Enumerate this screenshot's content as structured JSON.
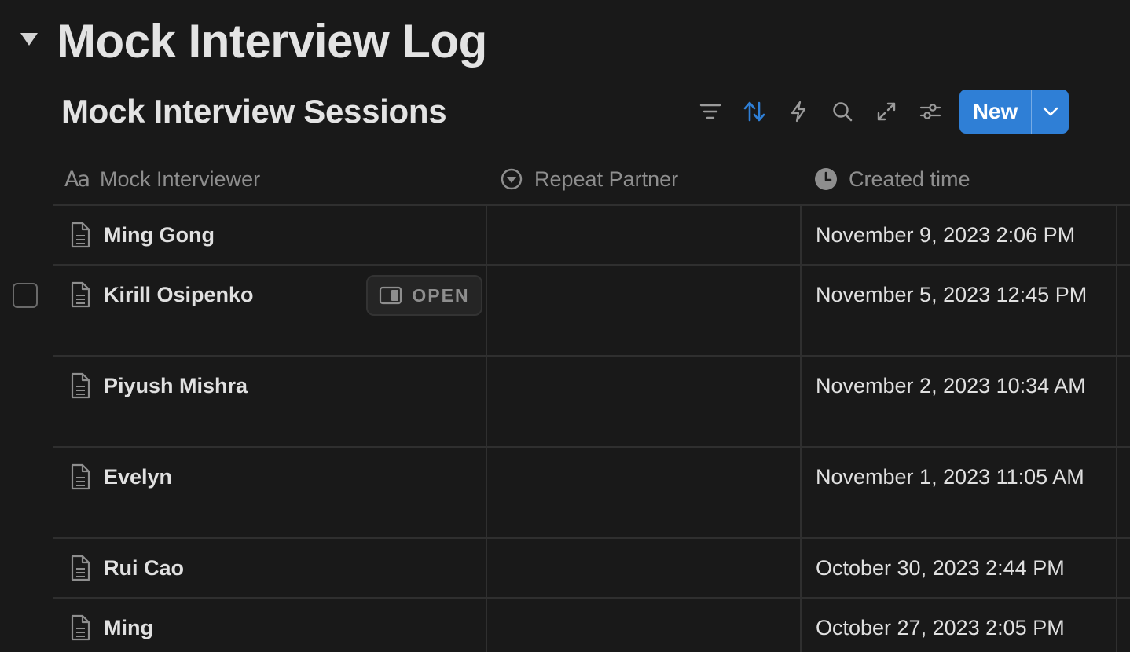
{
  "page": {
    "title": "Mock Interview Log"
  },
  "view": {
    "title": "Mock Interview Sessions"
  },
  "toolbar": {
    "icons": [
      "filter-icon",
      "sort-icon",
      "lightning-icon",
      "search-icon",
      "expand-icon",
      "settings-sliders-icon"
    ],
    "new_label": "New",
    "accent_color": "#2f7fd6",
    "active_icon_color": "#2f7fd6"
  },
  "table": {
    "columns": [
      {
        "label": "Mock Interviewer",
        "icon": "text-aa-icon"
      },
      {
        "label": "Repeat Partner",
        "icon": "select-chevron-icon"
      },
      {
        "label": "Created time",
        "icon": "clock-icon"
      }
    ],
    "open_label": "OPEN",
    "rows": [
      {
        "name": "Ming Gong",
        "repeat_partner": "",
        "created": "November 9, 2023 2:06 PM"
      },
      {
        "name": "Kirill Osipenko",
        "repeat_partner": "",
        "created": "November 5, 2023 12:45 PM"
      },
      {
        "name": "Piyush Mishra",
        "repeat_partner": "",
        "created": "November 2, 2023 10:34 AM"
      },
      {
        "name": "Evelyn",
        "repeat_partner": "",
        "created": "November 1, 2023 11:05 AM"
      },
      {
        "name": "Rui Cao",
        "repeat_partner": "",
        "created": "October 30, 2023 2:44 PM"
      },
      {
        "name": "Ming",
        "repeat_partner": "",
        "created": "October 27, 2023 2:05 PM"
      }
    ]
  }
}
